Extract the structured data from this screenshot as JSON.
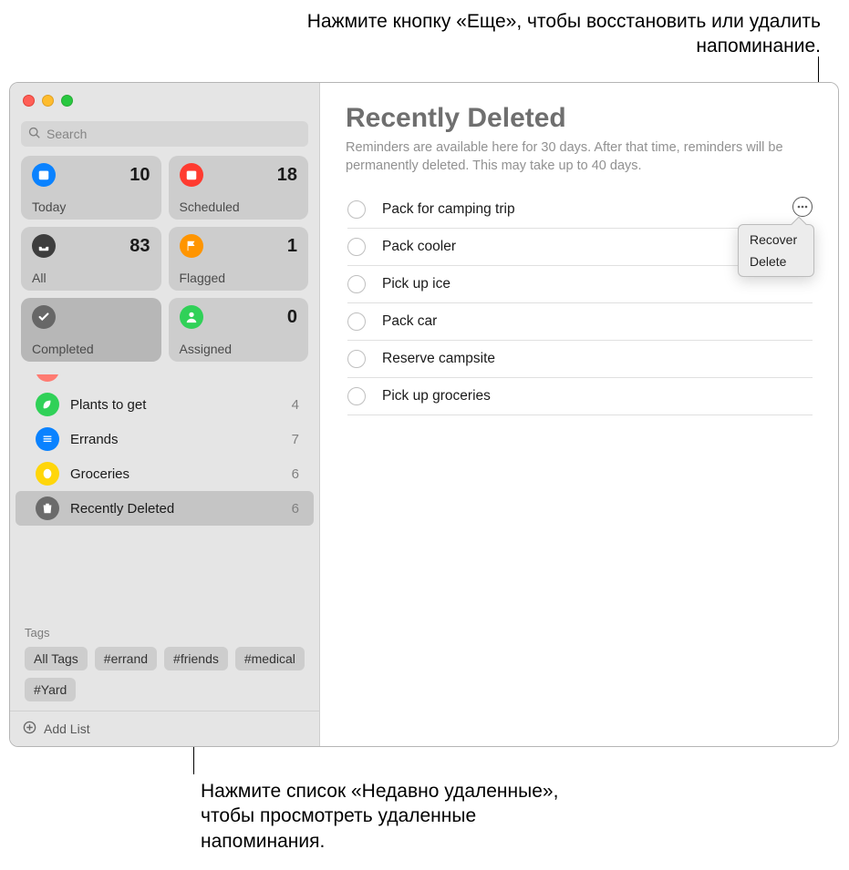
{
  "callouts": {
    "top": "Нажмите кнопку «Еще», чтобы восстановить или удалить напоминание.",
    "bottom": "Нажмите список «Недавно удаленные», чтобы просмотреть удаленные напоминания."
  },
  "search": {
    "placeholder": "Search"
  },
  "cards": [
    {
      "id": "today",
      "label": "Today",
      "count": "10",
      "color": "#0a82ff",
      "icon": "calendar"
    },
    {
      "id": "scheduled",
      "label": "Scheduled",
      "count": "18",
      "color": "#ff3b30",
      "icon": "calendar"
    },
    {
      "id": "all",
      "label": "All",
      "count": "83",
      "color": "#3d3d3d",
      "icon": "tray"
    },
    {
      "id": "flagged",
      "label": "Flagged",
      "count": "1",
      "color": "#ff9500",
      "icon": "flag"
    },
    {
      "id": "completed",
      "label": "Completed",
      "count": "",
      "color": "#676767",
      "icon": "check",
      "active": true
    },
    {
      "id": "assigned",
      "label": "Assigned",
      "count": "0",
      "color": "#30d158",
      "icon": "person"
    }
  ],
  "lists": [
    {
      "id": "partial",
      "name": "",
      "count": "",
      "color": "#ff7b72",
      "icon": "dot",
      "partial": true
    },
    {
      "id": "plants",
      "name": "Plants to get",
      "count": "4",
      "color": "#30d158",
      "icon": "leaf"
    },
    {
      "id": "errands",
      "name": "Errands",
      "count": "7",
      "color": "#0a82ff",
      "icon": "list"
    },
    {
      "id": "groceries",
      "name": "Groceries",
      "count": "6",
      "color": "#ffd60a",
      "icon": "lemon"
    },
    {
      "id": "deleted",
      "name": "Recently Deleted",
      "count": "6",
      "color": "#6b6b6b",
      "icon": "trash",
      "selected": true
    }
  ],
  "tags": {
    "header": "Tags",
    "items": [
      "All Tags",
      "#errand",
      "#friends",
      "#medical",
      "#Yard"
    ]
  },
  "addList": "Add List",
  "main": {
    "title": "Recently Deleted",
    "subtitle": "Reminders are available here for 30 days. After that time, reminders will be permanently deleted. This may take up to 40 days.",
    "items": [
      "Pack for camping trip",
      "Pack cooler",
      "Pick up ice",
      "Pack car",
      "Reserve campsite",
      "Pick up groceries"
    ],
    "popover": {
      "recover": "Recover",
      "delete": "Delete"
    }
  }
}
